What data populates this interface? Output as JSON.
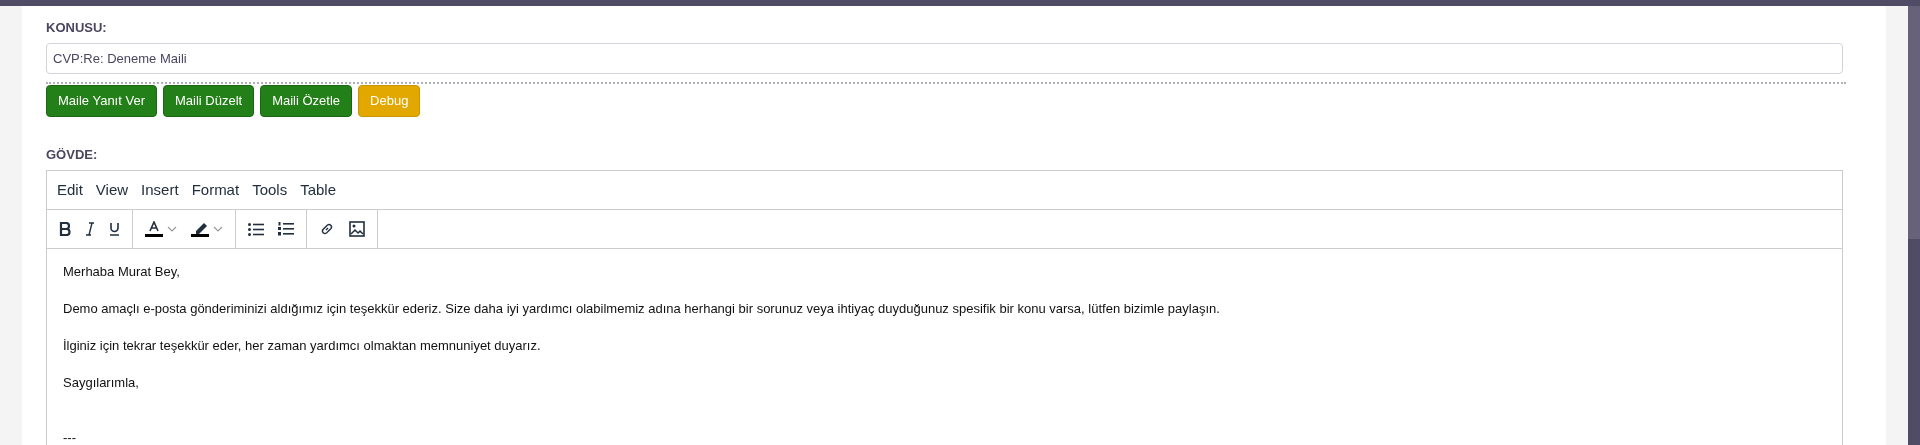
{
  "subject": {
    "label": "KONUSU:",
    "value": "CVP:Re: Deneme Maili"
  },
  "actions": [
    {
      "label": "Maile Yanıt Ver",
      "kind": "primary"
    },
    {
      "label": "Maili Düzelt",
      "kind": "primary"
    },
    {
      "label": "Maili Özetle",
      "kind": "primary"
    },
    {
      "label": "Debug",
      "kind": "warning"
    }
  ],
  "body": {
    "label": "GÖVDE:",
    "menu": [
      "Edit",
      "View",
      "Insert",
      "Format",
      "Tools",
      "Table"
    ],
    "toolbar": [
      [
        {
          "kind": "bold"
        },
        {
          "kind": "italic"
        },
        {
          "kind": "underline"
        }
      ],
      [
        {
          "kind": "text-color"
        },
        {
          "kind": "highlight"
        }
      ],
      [
        {
          "kind": "bullet-list"
        },
        {
          "kind": "numbered-list"
        }
      ],
      [
        {
          "kind": "link"
        },
        {
          "kind": "image"
        }
      ]
    ],
    "paragraphs": [
      {
        "text": "Merhaba Murat Bey,",
        "kind": "text"
      },
      {
        "text": "Demo amaçlı e-posta gönderiminizi aldığımız için teşekkür ederiz. Size daha iyi yardımcı olabilmemiz adına herhangi bir sorunuz veya ihtiyaç duyduğunuz spesifik bir konu varsa, lütfen bizimle paylaşın.",
        "kind": "text"
      },
      {
        "text": "İlginiz için tekrar teşekkür eder, her zaman yardımcı olmaktan memnuniyet duyarız.",
        "kind": "text"
      },
      {
        "text": "Saygılarımla,",
        "kind": "text"
      },
      {
        "text": "---",
        "kind": "separator"
      }
    ]
  }
}
